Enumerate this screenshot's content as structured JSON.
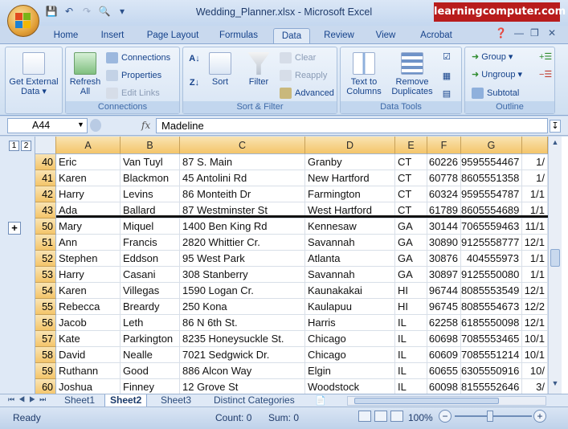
{
  "window": {
    "title": "Wedding_Planner.xlsx - Microsoft Excel",
    "badge": "learningcomputer.com"
  },
  "tabs": [
    "Home",
    "Insert",
    "Page Layout",
    "Formulas",
    "Data",
    "Review",
    "View",
    "Acrobat"
  ],
  "ribbon": {
    "get_external": "Get External Data",
    "connections_group": {
      "refresh": "Refresh All",
      "connections": "Connections",
      "properties": "Properties",
      "edit_links": "Edit Links",
      "label": "Connections"
    },
    "sort_filter_group": {
      "sort": "Sort",
      "filter": "Filter",
      "clear": "Clear",
      "reapply": "Reapply",
      "advanced": "Advanced",
      "label": "Sort & Filter"
    },
    "data_tools_group": {
      "text_to_columns": "Text to Columns",
      "remove_duplicates": "Remove Duplicates",
      "label": "Data Tools"
    },
    "outline_group": {
      "group": "Group",
      "ungroup": "Ungroup",
      "subtotal": "Subtotal",
      "label": "Outline"
    }
  },
  "formula_bar": {
    "name_box": "A44",
    "fx": "fx",
    "content": "Madeline"
  },
  "outline_levels": [
    "1",
    "2"
  ],
  "expand_symbol": "+",
  "columns": [
    "A",
    "B",
    "C",
    "D",
    "E",
    "F",
    "G",
    ""
  ],
  "rows": [
    {
      "n": "40",
      "a": "Eric",
      "b": "Van Tuyl",
      "c": "87 S. Main",
      "d": "Granby",
      "e": "CT",
      "f": "60226",
      "g": "9595554467",
      "h": "1/"
    },
    {
      "n": "41",
      "a": "Karen",
      "b": "Blackmon",
      "c": "45 Antolini Rd",
      "d": "New Hartford",
      "e": "CT",
      "f": "60778",
      "g": "8605551358",
      "h": "1/"
    },
    {
      "n": "42",
      "a": "Harry",
      "b": "Levins",
      "c": "86 Monteith Dr",
      "d": "Farmington",
      "e": "CT",
      "f": "60324",
      "g": "9595554787",
      "h": "1/1"
    },
    {
      "n": "43",
      "a": "Ada",
      "b": "Ballard",
      "c": "87 Westminster St",
      "d": "West Hartford",
      "e": "CT",
      "f": "61789",
      "g": "8605554689",
      "h": "1/1"
    },
    {
      "n": "50",
      "a": "Mary",
      "b": "Miquel",
      "c": "1400 Ben King Rd",
      "d": "Kennesaw",
      "e": "GA",
      "f": "30144",
      "g": "7065559463",
      "h": "11/1"
    },
    {
      "n": "51",
      "a": "Ann",
      "b": "Francis",
      "c": "2820 Whittier Cr.",
      "d": "Savannah",
      "e": "GA",
      "f": "30890",
      "g": "9125558777",
      "h": "12/1"
    },
    {
      "n": "52",
      "a": "Stephen",
      "b": "Eddson",
      "c": "95 West Park",
      "d": "Atlanta",
      "e": "GA",
      "f": "30876",
      "g": "404555973",
      "h": "1/1"
    },
    {
      "n": "53",
      "a": "Harry",
      "b": "Casani",
      "c": "308 Stanberry",
      "d": "Savannah",
      "e": "GA",
      "f": "30897",
      "g": "9125550080",
      "h": "1/1"
    },
    {
      "n": "54",
      "a": "Karen",
      "b": "Villegas",
      "c": "1590 Logan Cr.",
      "d": "Kaunakakai",
      "e": "HI",
      "f": "96744",
      "g": "8085553549",
      "h": "12/1"
    },
    {
      "n": "55",
      "a": "Rebecca",
      "b": "Breardy",
      "c": "250 Kona",
      "d": "Kaulapuu",
      "e": "HI",
      "f": "96745",
      "g": "8085554673",
      "h": "12/2"
    },
    {
      "n": "56",
      "a": "Jacob",
      "b": "Leth",
      "c": "86 N 6th St.",
      "d": "Harris",
      "e": "IL",
      "f": "62258",
      "g": "6185550098",
      "h": "12/1"
    },
    {
      "n": "57",
      "a": "Kate",
      "b": "Parkington",
      "c": "8235 Honeysuckle St.",
      "d": "Chicago",
      "e": "IL",
      "f": "60698",
      "g": "7085553465",
      "h": "10/1"
    },
    {
      "n": "58",
      "a": "David",
      "b": "Nealle",
      "c": "7021 Sedgwick Dr.",
      "d": "Chicago",
      "e": "IL",
      "f": "60609",
      "g": "7085551214",
      "h": "10/1"
    },
    {
      "n": "59",
      "a": "Ruthann",
      "b": "Good",
      "c": "886 Alcon Way",
      "d": "Elgin",
      "e": "IL",
      "f": "60655",
      "g": "6305550916",
      "h": "10/"
    },
    {
      "n": "60",
      "a": "Joshua",
      "b": "Finney",
      "c": "12 Grove St",
      "d": "Woodstock",
      "e": "IL",
      "f": "60098",
      "g": "8155552646",
      "h": "3/"
    }
  ],
  "sheets": [
    "Sheet1",
    "Sheet2",
    "Sheet3",
    "Distinct Categories"
  ],
  "status": {
    "ready": "Ready",
    "count": "Count: 0",
    "sum": "Sum: 0",
    "zoom": "100%"
  }
}
